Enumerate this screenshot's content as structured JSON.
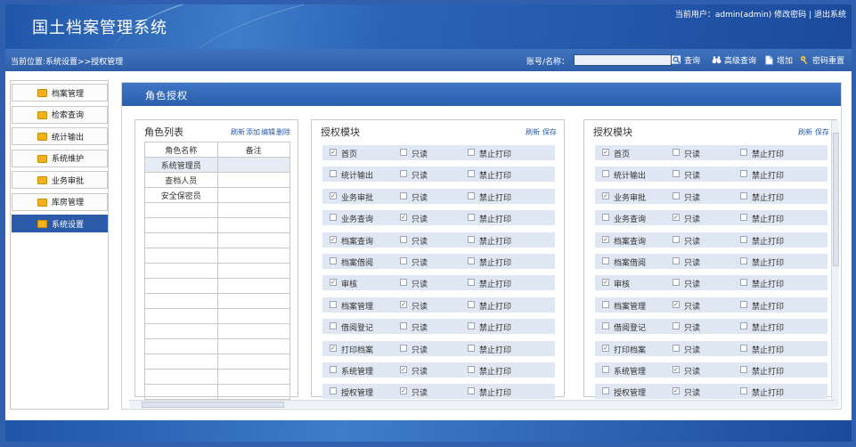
{
  "app": {
    "title": "国土档案管理系统"
  },
  "user": {
    "label": "当前用户：admin(admin)",
    "change_pw": "修改密码",
    "sep": "|",
    "logout": "退出系统"
  },
  "toolbar": {
    "breadcrumb": "当前位置:系统设置>>授权管理",
    "search_label": "账号/名称：",
    "search_value": "",
    "query": "查询",
    "advanced": "高级查询",
    "add": "增加",
    "reset_pw": "密码重置"
  },
  "sidebar": {
    "items": [
      {
        "label": "档案管理"
      },
      {
        "label": "检索查询"
      },
      {
        "label": "统计输出"
      },
      {
        "label": "系统维护"
      },
      {
        "label": "业务审批"
      },
      {
        "label": "库房管理"
      },
      {
        "label": "系统设置"
      }
    ]
  },
  "main": {
    "title": "角色授权"
  },
  "roles": {
    "title": "角色列表",
    "actions": [
      "刷新",
      "添加",
      "编辑",
      "删除"
    ],
    "headers": [
      "角色名称",
      "备注"
    ],
    "rows": [
      "系统管理员",
      "查档人员",
      "安全保密员"
    ]
  },
  "modules": {
    "title": "授权模块",
    "actions": [
      "刷新",
      "保存"
    ],
    "readonly_label": "只读",
    "noprint_label": "禁止打印",
    "rows": [
      {
        "name": "首页",
        "checked": true,
        "readonly": false
      },
      {
        "name": "统计输出",
        "checked": false,
        "readonly": false
      },
      {
        "name": "业务审批",
        "checked": true,
        "readonly": false
      },
      {
        "name": "业务查询",
        "checked": false,
        "readonly": true
      },
      {
        "name": "档案查询",
        "checked": true,
        "readonly": false
      },
      {
        "name": "档案借阅",
        "checked": false,
        "readonly": false
      },
      {
        "name": "审核",
        "checked": true,
        "readonly": false
      },
      {
        "name": "档案管理",
        "checked": false,
        "readonly": true
      },
      {
        "name": "借阅登记",
        "checked": false,
        "readonly": false
      },
      {
        "name": "打印档案",
        "checked": true,
        "readonly": false
      },
      {
        "name": "系统管理",
        "checked": false,
        "readonly": true
      },
      {
        "name": "授权管理",
        "checked": false,
        "readonly": true
      }
    ]
  },
  "colors": {
    "header": "#2b5aa8",
    "row": "#dfe7f3",
    "folder": "#f2b21c"
  }
}
